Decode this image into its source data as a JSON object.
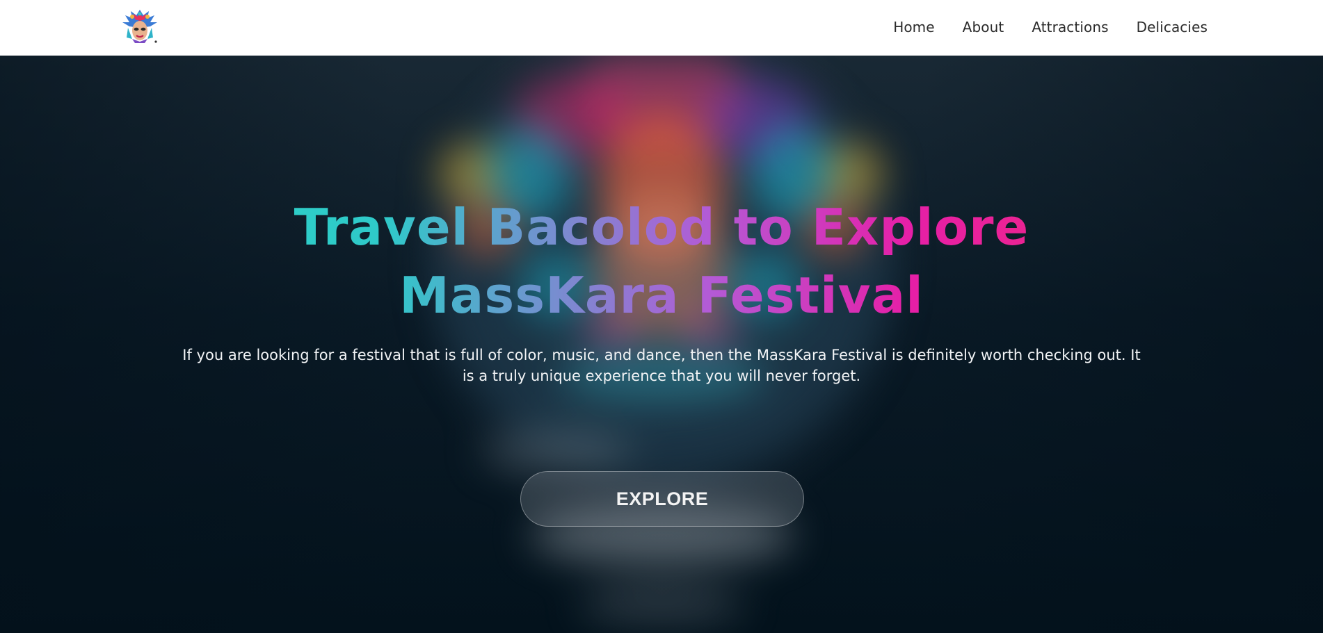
{
  "nav": {
    "logo_icon": "masskara-mask-logo",
    "links": [
      "Home",
      "About",
      "Attractions",
      "Delicacies"
    ]
  },
  "hero": {
    "title": "Travel Bacolod to Explore MassKara Festival",
    "description": "If you are looking for a festival that is full of color, music, and dance, then the MassKara Festival is definitely worth checking out. It is a truly unique experience that you will never forget.",
    "button_label": "EXPLORE",
    "background_image": "blurred-masskara-mask-image"
  },
  "colors": {
    "nav_bg": "#ffffff",
    "nav_text": "#2b2b2b",
    "title_gradient_start": "#2cd3c6",
    "title_gradient_mid": "#b45ad6",
    "title_gradient_end": "#f0287e",
    "hero_bg": "#05121c"
  }
}
